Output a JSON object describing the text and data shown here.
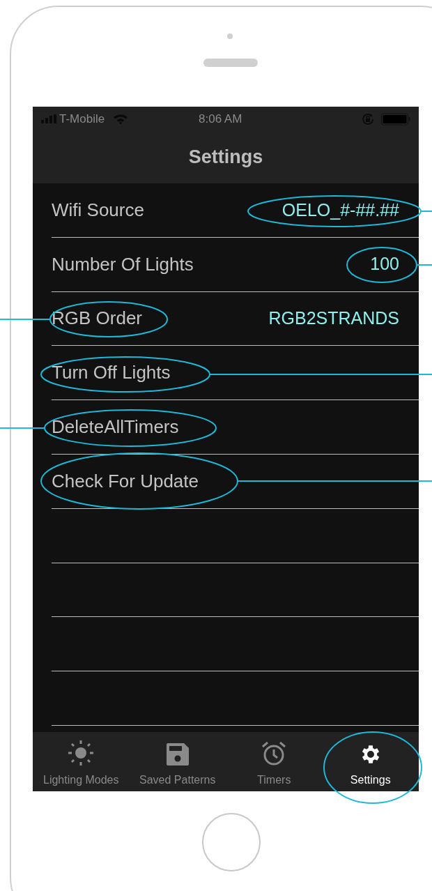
{
  "status_bar": {
    "carrier": "T-Mobile",
    "time": "8:06 AM"
  },
  "nav": {
    "title": "Settings"
  },
  "rows": [
    {
      "label": "Wifi Source",
      "value": "OELO_#-##.##"
    },
    {
      "label": "Number Of Lights",
      "value": "100"
    },
    {
      "label": "RGB Order",
      "value": "RGB2STRANDS"
    },
    {
      "label": "Turn Off Lights"
    },
    {
      "label": "DeleteAllTimers"
    },
    {
      "label": "Check For Update"
    }
  ],
  "tabs": [
    {
      "label": "Lighting Modes",
      "kind": "sun",
      "selected": false
    },
    {
      "label": "Saved Patterns",
      "kind": "floppy",
      "selected": false
    },
    {
      "label": "Timers",
      "kind": "alarm",
      "selected": false
    },
    {
      "label": "Settings",
      "kind": "gear",
      "selected": true
    }
  ]
}
